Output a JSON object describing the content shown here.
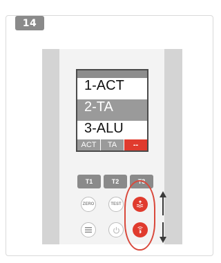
{
  "step": {
    "number": "14"
  },
  "screen": {
    "menu_items": [
      "1-ACT",
      "2-TA",
      "3-ALU"
    ],
    "selected_index": 1,
    "softkeys": [
      "ACT",
      "TA",
      "--"
    ],
    "active_softkey": "--"
  },
  "keys": {
    "t1": "T1",
    "t2": "T2",
    "t3": "T3",
    "zero": "ZERO",
    "test": "TEST"
  },
  "icons": {
    "upper_red": "surface-waves-icon",
    "lower_red": "bluetooth-icon",
    "menu": "menu-icon",
    "power": "power-icon",
    "arrow_up": "arrow-up-icon",
    "arrow_down": "arrow-down-icon"
  },
  "colors": {
    "accent": "#e03b2e",
    "badge": "#8a8a8a",
    "device_side": "#d4d4d4",
    "device_face": "#f3f3f3"
  }
}
